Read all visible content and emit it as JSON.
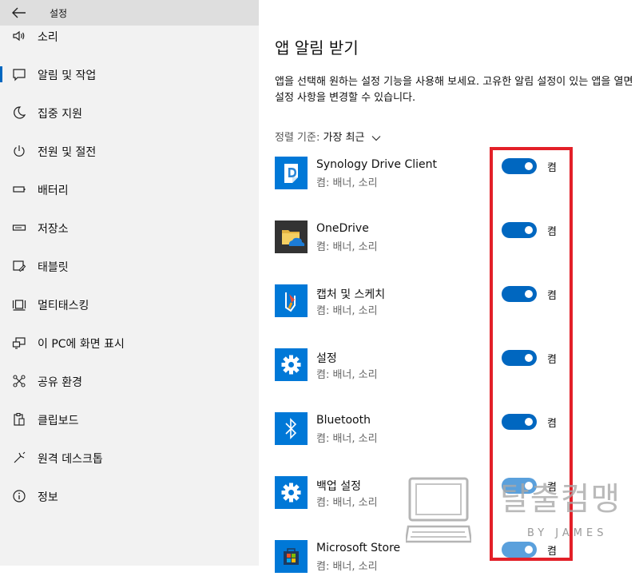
{
  "window": {
    "title": "설정"
  },
  "sidebar": {
    "items": [
      {
        "label": "소리",
        "icon": "speaker-icon"
      },
      {
        "label": "알림 및 작업",
        "icon": "message-icon",
        "active": true
      },
      {
        "label": "집중 지원",
        "icon": "moon-icon"
      },
      {
        "label": "전원 및 절전",
        "icon": "power-icon"
      },
      {
        "label": "배터리",
        "icon": "battery-icon"
      },
      {
        "label": "저장소",
        "icon": "storage-icon"
      },
      {
        "label": "태블릿",
        "icon": "tablet-icon"
      },
      {
        "label": "멀티태스킹",
        "icon": "multitasking-icon"
      },
      {
        "label": "이 PC에 화면 표시",
        "icon": "project-icon"
      },
      {
        "label": "공유 환경",
        "icon": "share-icon"
      },
      {
        "label": "클립보드",
        "icon": "clipboard-icon"
      },
      {
        "label": "원격 데스크톱",
        "icon": "remote-desktop-icon"
      },
      {
        "label": "정보",
        "icon": "info-icon"
      }
    ]
  },
  "main": {
    "title": "앱 알림 받기",
    "description": "앱을 선택해 원하는 설정 기능을 사용해 보세요. 고유한 알림 설정이 있는 앱을 열면 설정 사항을 변경할 수 있습니다.",
    "sort_label": "정렬 기준:",
    "sort_value": "가장 최근",
    "apps": [
      {
        "name": "Synology Drive Client",
        "status": "켬: 배너, 소리",
        "toggle_label": "켬",
        "on": true
      },
      {
        "name": "OneDrive",
        "status": "켬: 배너, 소리",
        "toggle_label": "켬",
        "on": true
      },
      {
        "name": "캡처 및 스케치",
        "status": "켬: 배너, 소리",
        "toggle_label": "켬",
        "on": true
      },
      {
        "name": "설정",
        "status": "켬: 배너, 소리",
        "toggle_label": "켬",
        "on": true
      },
      {
        "name": "Bluetooth",
        "status": "켬: 배너, 소리",
        "toggle_label": "켬",
        "on": true
      },
      {
        "name": "백업 설정",
        "status": "켬: 배너, 소리",
        "toggle_label": "켬",
        "on": true
      },
      {
        "name": "Microsoft Store",
        "status": "켬: 배너, 소리",
        "toggle_label": "켬",
        "on": true
      }
    ]
  },
  "watermark": {
    "text": "탈출컴맹",
    "sub": "BY JAMES"
  },
  "colors": {
    "accent": "#0067c0",
    "highlight": "#e32028",
    "tile": "#0078d7"
  }
}
